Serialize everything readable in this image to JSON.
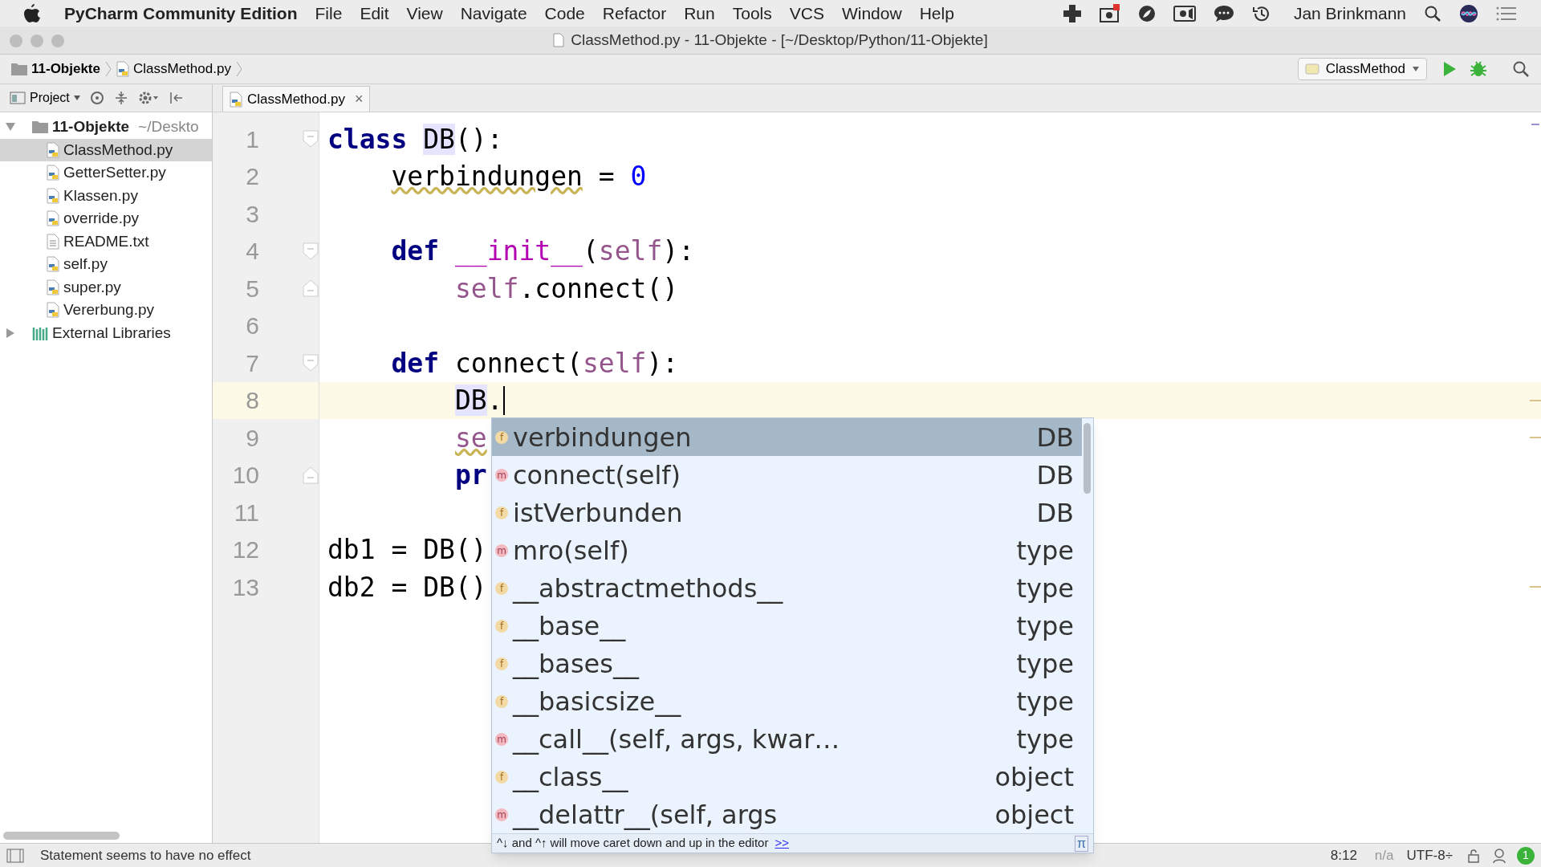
{
  "menu_bar": {
    "app_name": "PyCharm Community Edition",
    "menus": [
      "File",
      "Edit",
      "View",
      "Navigate",
      "Code",
      "Refactor",
      "Run",
      "Tools",
      "VCS",
      "Window",
      "Help"
    ],
    "user": "Jan Brinkmann"
  },
  "window": {
    "title": "ClassMethod.py - 11-Objekte - [~/Desktop/Python/11-Objekte]"
  },
  "breadcrumbs": [
    {
      "kind": "folder",
      "label": "11-Objekte"
    },
    {
      "kind": "python",
      "label": "ClassMethod.py"
    }
  ],
  "run_config": "ClassMethod",
  "project_tool": {
    "label": "Project"
  },
  "tabs": [
    {
      "label": "ClassMethod.py",
      "selected": true,
      "close": "×"
    }
  ],
  "tree": [
    {
      "kind": "folder",
      "label": "11-Objekte",
      "path": "~/Deskto",
      "expanded": true,
      "selected": false,
      "children": [
        {
          "kind": "python",
          "label": "ClassMethod.py",
          "selected": true
        },
        {
          "kind": "python",
          "label": "GetterSetter.py",
          "selected": false
        },
        {
          "kind": "python",
          "label": "Klassen.py",
          "selected": false
        },
        {
          "kind": "python",
          "label": "override.py",
          "selected": false
        },
        {
          "kind": "text",
          "label": "README.txt",
          "selected": false
        },
        {
          "kind": "python",
          "label": "self.py",
          "selected": false
        },
        {
          "kind": "python",
          "label": "super.py",
          "selected": false
        },
        {
          "kind": "python",
          "label": "Vererbung.py",
          "selected": false
        }
      ]
    },
    {
      "kind": "library",
      "label": "External Libraries",
      "expanded": false,
      "selected": false
    }
  ],
  "code_lines": [
    {
      "number": "1",
      "fold_start": true,
      "fold_end": false,
      "current": false,
      "tokens": [
        {
          "kind": "keyword",
          "text": "class "
        },
        {
          "kind": "usage",
          "text": "DB"
        },
        {
          "kind": "plain",
          "text": "():"
        }
      ]
    },
    {
      "number": "2",
      "fold_start": false,
      "fold_end": false,
      "current": false,
      "tokens": [
        {
          "kind": "warning",
          "text": "    verbindungen"
        },
        {
          "kind": "plain",
          "text": " = "
        },
        {
          "kind": "number",
          "text": "0"
        }
      ]
    },
    {
      "number": "3",
      "fold_start": false,
      "fold_end": false,
      "current": false
    },
    {
      "number": "4",
      "fold_start": true,
      "fold_end": false,
      "current": false,
      "tokens": [
        {
          "kind": "keyword",
          "text": "    def "
        },
        {
          "kind": "dunder",
          "text": "__init__"
        },
        {
          "kind": "plain",
          "text": "("
        },
        {
          "kind": "self",
          "text": "self"
        },
        {
          "kind": "plain",
          "text": "):"
        }
      ]
    },
    {
      "number": "5",
      "fold_start": false,
      "fold_end": true,
      "current": false,
      "tokens": [
        {
          "kind": "self",
          "text": "        self"
        },
        {
          "kind": "plain",
          "text": ".connect()"
        }
      ]
    },
    {
      "number": "6",
      "fold_start": false,
      "fold_end": false,
      "current": false
    },
    {
      "number": "7",
      "fold_start": true,
      "fold_end": false,
      "current": false,
      "tokens": [
        {
          "kind": "keyword",
          "text": "    def "
        },
        {
          "kind": "plain",
          "text": "connect("
        },
        {
          "kind": "self",
          "text": "self"
        },
        {
          "kind": "plain",
          "text": "):"
        }
      ]
    },
    {
      "number": "8",
      "fold_start": false,
      "fold_end": false,
      "current": true,
      "tokens": [
        {
          "kind": "usage",
          "text": "        DB"
        },
        {
          "kind": "plain",
          "text": "."
        }
      ]
    },
    {
      "number": "9",
      "fold_start": false,
      "fold_end": false,
      "current": false,
      "tokens": [
        {
          "kind": "self_warning",
          "text": "        se"
        }
      ]
    },
    {
      "number": "10",
      "fold_start": false,
      "fold_end": true,
      "current": false,
      "tokens": [
        {
          "kind": "keyword",
          "text": "        pr"
        }
      ]
    },
    {
      "number": "11",
      "fold_start": false,
      "fold_end": false,
      "current": false
    },
    {
      "number": "12",
      "fold_start": false,
      "fold_end": false,
      "current": false,
      "tokens": [
        {
          "kind": "plain",
          "text": "db1 = DB()"
        }
      ]
    },
    {
      "number": "13",
      "fold_start": false,
      "fold_end": false,
      "current": false,
      "tokens": [
        {
          "kind": "plain",
          "text": "db2 = DB()"
        }
      ]
    }
  ],
  "completion": {
    "items": [
      {
        "kind": "f",
        "name": "verbindungen",
        "type": "DB",
        "selected": true
      },
      {
        "kind": "m",
        "name": "connect(self)",
        "type": "DB",
        "selected": false
      },
      {
        "kind": "f",
        "name": "istVerbunden",
        "type": "DB",
        "selected": false
      },
      {
        "kind": "m",
        "name": "mro(self)",
        "type": "type",
        "selected": false
      },
      {
        "kind": "f",
        "name": "__abstractmethods__",
        "type": "type",
        "selected": false
      },
      {
        "kind": "f",
        "name": "__base__",
        "type": "type",
        "selected": false
      },
      {
        "kind": "f",
        "name": "__bases__",
        "type": "type",
        "selected": false
      },
      {
        "kind": "f",
        "name": "__basicsize__",
        "type": "type",
        "selected": false
      },
      {
        "kind": "m",
        "name": "__call__(self, args, kwar…",
        "type": "type",
        "selected": false
      },
      {
        "kind": "f",
        "name": "__class__",
        "type": "object",
        "selected": false
      },
      {
        "kind": "m",
        "name": "__delattr__(self, args",
        "type": "object",
        "selected": false
      }
    ],
    "hint": "^↓ and ^↑ will move caret down and up in the editor",
    "hint_link": ">>",
    "pi": "π"
  },
  "status_bar": {
    "message": "Statement seems to have no effect",
    "position": "8:12",
    "line_sep": "n/a",
    "encoding": "UTF-8÷",
    "notifications": "1"
  }
}
